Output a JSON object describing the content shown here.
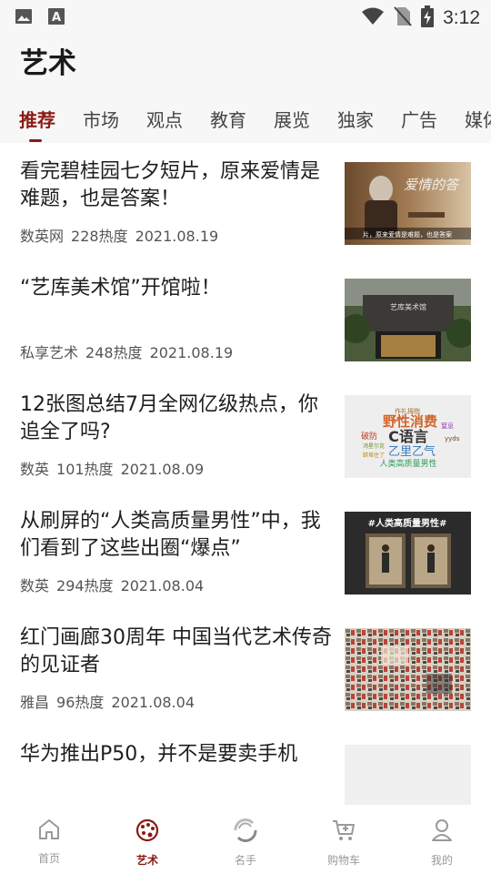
{
  "status_bar": {
    "time": "3:12",
    "icons": [
      "image-icon",
      "font-icon",
      "wifi-icon",
      "no-sim-icon",
      "battery-charging-icon"
    ]
  },
  "header": {
    "title": "艺术"
  },
  "tabs": [
    {
      "label": "推荐",
      "active": true
    },
    {
      "label": "市场"
    },
    {
      "label": "观点"
    },
    {
      "label": "教育"
    },
    {
      "label": "展览"
    },
    {
      "label": "独家"
    },
    {
      "label": "广告"
    },
    {
      "label": "媒体"
    }
  ],
  "articles": [
    {
      "title": "看完碧桂园七夕短片，原来爱情是难题，也是答案！",
      "source": "数英网",
      "heat": "228热度",
      "date": "2021.08.19",
      "thumb_caption": "片，原来爱情是难题，也是答案",
      "thumb_overlay": "爱情的答"
    },
    {
      "title": "“艺库美术馆”开馆啦！",
      "source": "私享艺术",
      "heat": "248热度",
      "date": "2021.08.19",
      "thumb_sign": "艺库美术馆"
    },
    {
      "title": "12张图总结7月全网亿级热点，你追全了吗?",
      "source": "数英",
      "heat": "101热度",
      "date": "2021.08.09",
      "thumb_words": [
        "作礼拇指",
        "野性消费",
        "C语言",
        "破防",
        "乙里乙气",
        "人类高质量男性",
        "窒息",
        "鸿星尔克",
        "蚌埠住了",
        "yyds"
      ]
    },
    {
      "title": "从刷屏的“人类高质量男性”中，我们看到了这些出圈“爆点”",
      "source": "数英",
      "heat": "294热度",
      "date": "2021.08.04",
      "thumb_banner": "#人类高质量男性#"
    },
    {
      "title": "红门画廊30周年 中国当代艺术传奇的见证者",
      "source": "雅昌",
      "heat": "96热度",
      "date": "2021.08.04"
    },
    {
      "title": "华为推出P50，并不是要卖手机",
      "source": "",
      "heat": "",
      "date": ""
    }
  ],
  "bottom_nav": [
    {
      "label": "首页",
      "icon": "home-icon"
    },
    {
      "label": "艺术",
      "icon": "palette-icon",
      "active": true
    },
    {
      "label": "名手",
      "icon": "swirl-icon"
    },
    {
      "label": "购物车",
      "icon": "cart-icon"
    },
    {
      "label": "我的",
      "icon": "user-icon"
    }
  ],
  "colors": {
    "accent": "#8b1a14",
    "inactive": "#999999",
    "background_top": "#f7f7f7"
  }
}
